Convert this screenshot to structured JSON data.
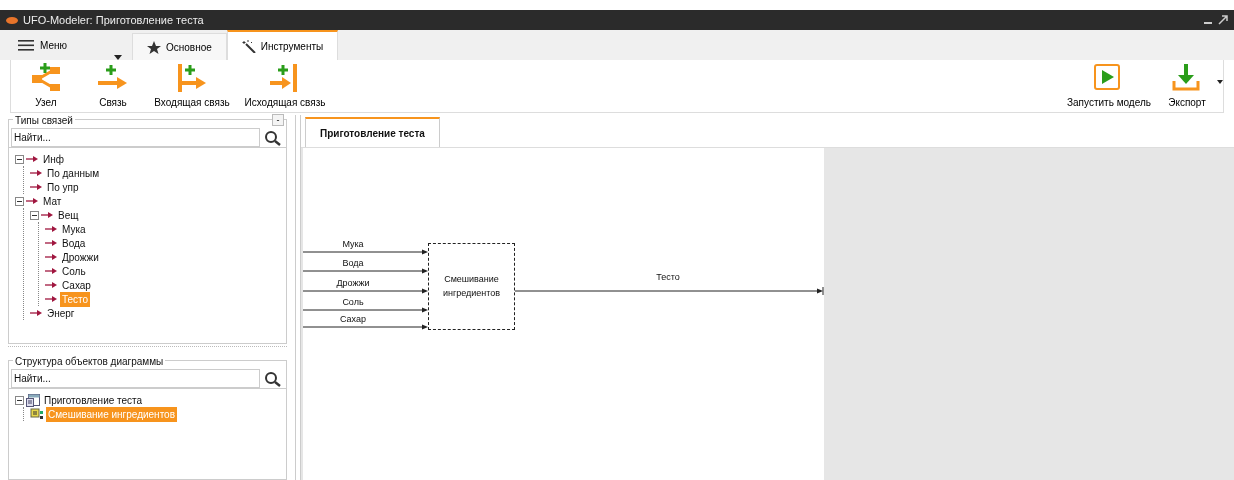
{
  "window": {
    "title": "UFO-Modeler: Приготовление теста"
  },
  "menu": {
    "label": "Меню"
  },
  "ribbon_tabs": [
    {
      "label": "Основное",
      "selected": false,
      "kind": "star"
    },
    {
      "label": "Инструменты",
      "selected": true,
      "kind": "wand"
    }
  ],
  "tools": [
    {
      "label": "Узел",
      "kind": "node"
    },
    {
      "label": "Связь",
      "kind": "link"
    },
    {
      "label": "Входящая связь",
      "kind": "in"
    },
    {
      "label": "Исходящая связь",
      "kind": "out"
    }
  ],
  "right_tools": [
    {
      "label": "Запустить модель",
      "kind": "run"
    },
    {
      "label": "Экспорт",
      "kind": "export"
    }
  ],
  "link_types": {
    "title": "Типы связей",
    "collapse_button": "-",
    "search": {
      "placeholder": "Найти..."
    },
    "tree": [
      {
        "label": "Инф",
        "expanded": true,
        "selected": false,
        "children": [
          {
            "label": "По данным",
            "selected": false
          },
          {
            "label": "По упр",
            "selected": false
          }
        ]
      },
      {
        "label": "Мат",
        "expanded": true,
        "selected": false,
        "children": [
          {
            "label": "Вещ",
            "expanded": true,
            "selected": false,
            "children": [
              {
                "label": "Мука",
                "selected": false
              },
              {
                "label": "Вода",
                "selected": false
              },
              {
                "label": "Дрожжи",
                "selected": false
              },
              {
                "label": "Соль",
                "selected": false
              },
              {
                "label": "Сахар",
                "selected": false
              },
              {
                "label": "Тесто",
                "selected": true
              }
            ]
          },
          {
            "label": "Энерг",
            "selected": false
          }
        ]
      }
    ]
  },
  "structure": {
    "title": "Структура объектов диаграммы",
    "search": {
      "placeholder": "Найти..."
    },
    "tree": [
      {
        "label": "Приготовление теста",
        "kind": "diagram",
        "expanded": true,
        "selected": false,
        "children": [
          {
            "label": "Смешивание ингредиентов",
            "kind": "process",
            "selected": true
          }
        ]
      }
    ]
  },
  "document_tabs": [
    {
      "label": "Приготовление теста",
      "selected": true
    }
  ],
  "diagram": {
    "process": {
      "label": "Смешивание ингредиентов"
    },
    "inputs": [
      "Мука",
      "Вода",
      "Дрожжи",
      "Соль",
      "Сахар"
    ],
    "output": "Тесто"
  }
}
